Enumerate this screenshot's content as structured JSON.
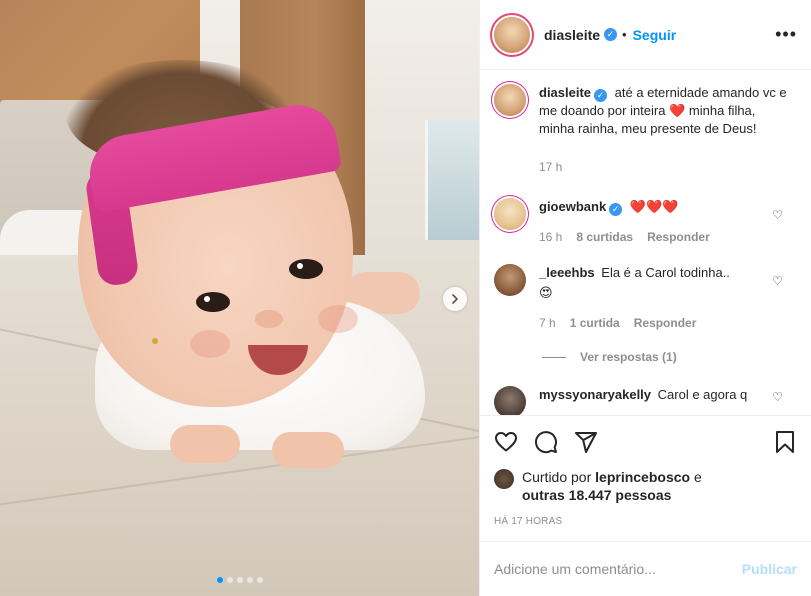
{
  "post": {
    "username": "diasleite",
    "follow_label": "Seguir",
    "separator": "•",
    "more_label": "•••"
  },
  "caption": {
    "username": "diasleite",
    "text_before": "até a eternidade amando vc e me doando por inteira",
    "emoji": "❤️",
    "text_after": "minha filha, minha rainha, meu presente de Deus!",
    "time": "17 h"
  },
  "comments": [
    {
      "username": "gioewbank",
      "verified": true,
      "text": "❤️❤️❤️",
      "time": "16 h",
      "likes": "8 curtidas",
      "reply": "Responder"
    },
    {
      "username": "_leeehbs",
      "verified": false,
      "text": "Ela é a Carol todinha..",
      "emoji_line": "😍",
      "time": "7 h",
      "likes": "1 curtida",
      "reply": "Responder",
      "view_replies": "Ver respostas (1)"
    },
    {
      "username": "myssyonaryakelly",
      "verified": false,
      "text": "Carol e agora q"
    }
  ],
  "likes": {
    "prefix": "Curtido por",
    "user": "leprincebosco",
    "conj": "e",
    "others": "outras 18.447 pessoas"
  },
  "timestamp": "HÁ 17 HORAS",
  "add_comment": {
    "placeholder": "Adicione um comentário...",
    "publish_label": "Publicar"
  },
  "carousel": {
    "slides": 5,
    "active_index": 0
  },
  "colors": {
    "accent_blue": "#0095f6",
    "verified_blue": "#3897f0",
    "heart_red": "#ed4956",
    "headband_pink": "#e54a9c",
    "publish_disabled": "#b2dffc"
  },
  "icons": [
    "verified-badge-icon",
    "more-options-icon",
    "heart-outline-icon",
    "comment-icon",
    "share-icon",
    "bookmark-icon",
    "carousel-next-icon"
  ]
}
